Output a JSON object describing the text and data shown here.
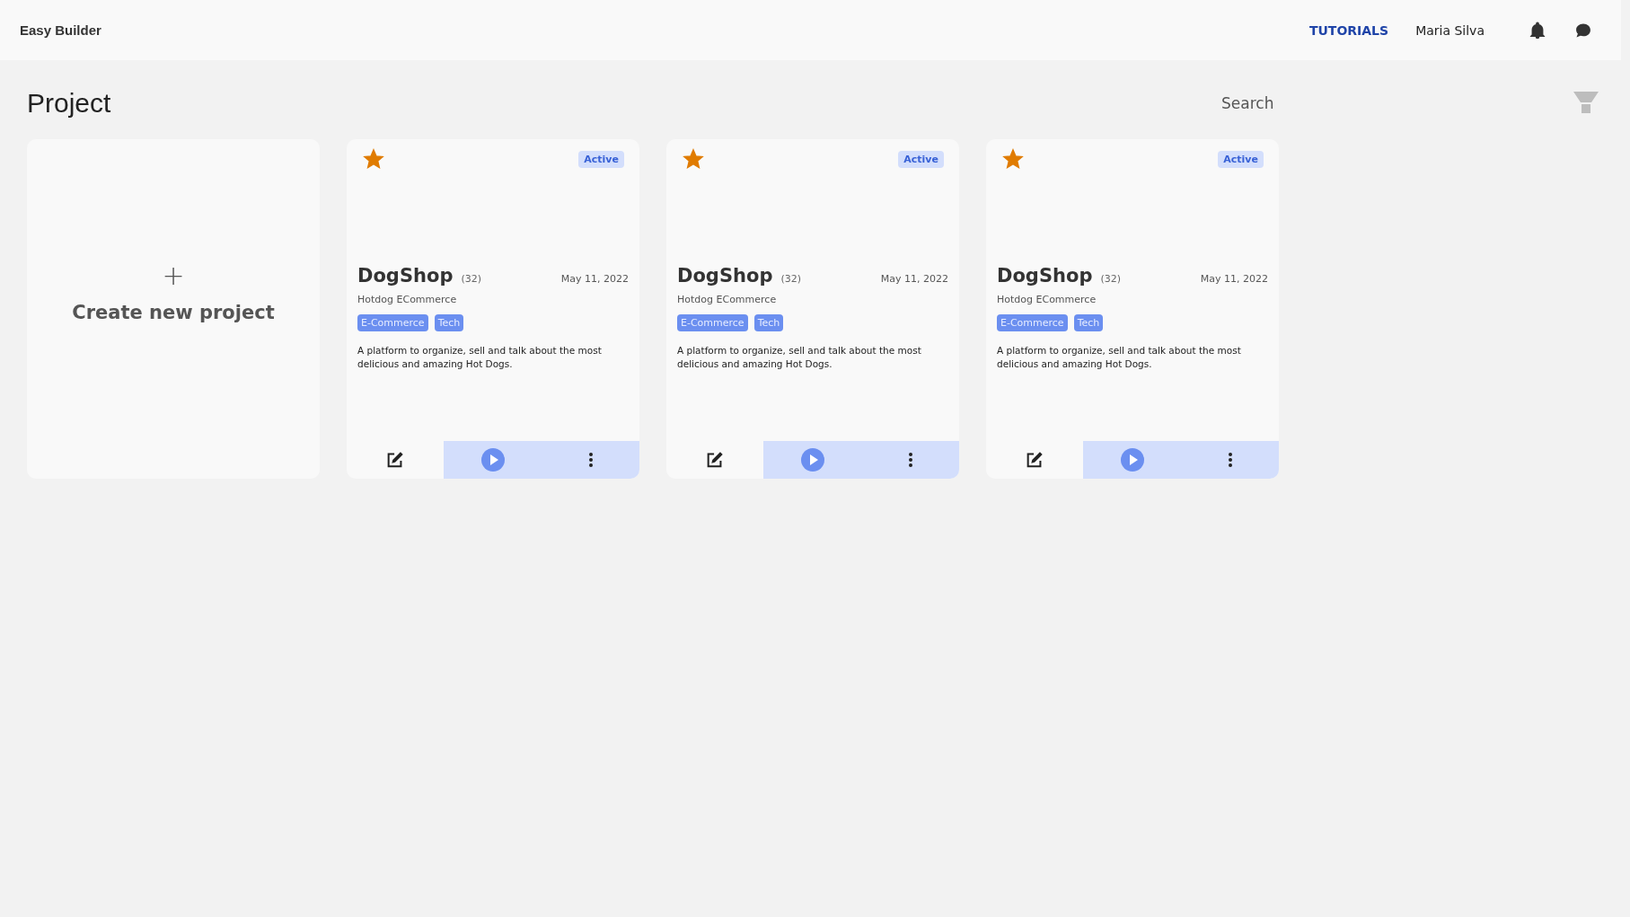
{
  "header": {
    "brand": "Easy Builder",
    "links": [
      {
        "label": "TUTORIALS"
      }
    ],
    "user": "Maria Silva"
  },
  "page": {
    "title": "Project",
    "search": {
      "placeholder": "Search"
    }
  },
  "create_card": {
    "icon": "+",
    "label": "Create new project"
  },
  "projects": [
    {
      "starred": true,
      "status": "Active",
      "name": "DogShop",
      "count": "(32)",
      "date": "May 11, 2022",
      "subtitle": "Hotdog ECommerce",
      "tags": [
        "E-Commerce",
        "Tech"
      ],
      "description": "A platform to organize, sell and talk about the most delicious and amazing Hot Dogs."
    },
    {
      "starred": true,
      "status": "Active",
      "name": "DogShop",
      "count": "(32)",
      "date": "May 11, 2022",
      "subtitle": "Hotdog ECommerce",
      "tags": [
        "E-Commerce",
        "Tech"
      ],
      "description": "A platform to organize, sell and talk about the most delicious and amazing Hot Dogs."
    },
    {
      "starred": true,
      "status": "Active",
      "name": "DogShop",
      "count": "(32)",
      "date": "May 11, 2022",
      "subtitle": "Hotdog ECommerce",
      "tags": [
        "E-Commerce",
        "Tech"
      ],
      "description": "A platform to organize, sell and talk about the most delicious and amazing Hot Dogs."
    }
  ]
}
